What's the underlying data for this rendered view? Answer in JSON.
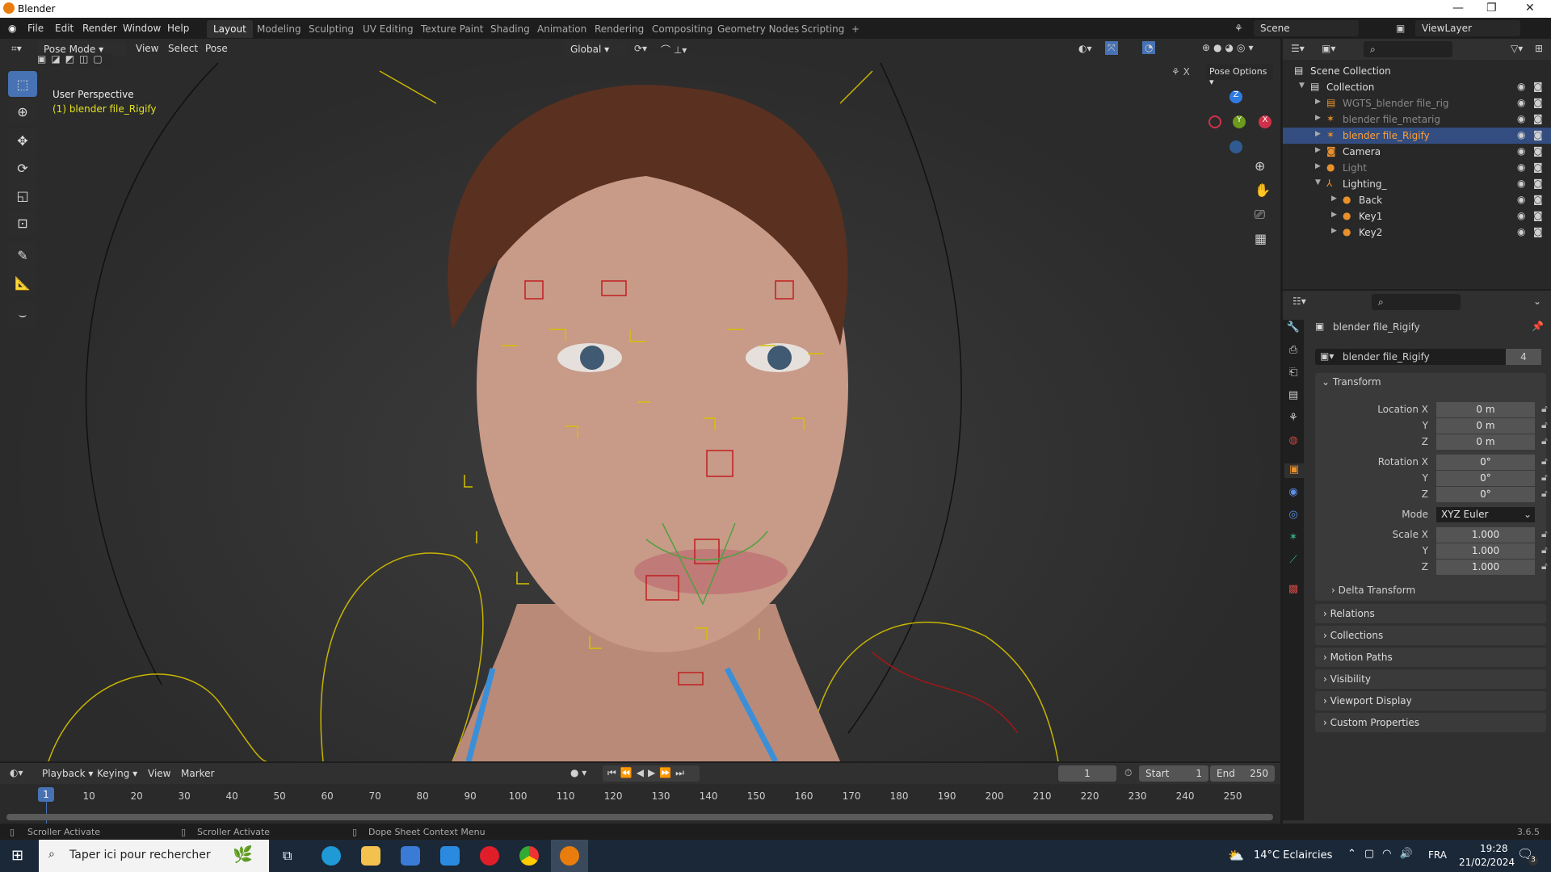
{
  "window": {
    "title": "Blender",
    "controls": [
      "—",
      "❐",
      "✕"
    ]
  },
  "menu": {
    "items": [
      "File",
      "Edit",
      "Render",
      "Window",
      "Help"
    ],
    "workspaces": [
      "Layout",
      "Modeling",
      "Sculpting",
      "UV Editing",
      "Texture Paint",
      "Shading",
      "Animation",
      "Rendering",
      "Compositing",
      "Geometry Nodes",
      "Scripting",
      "+"
    ],
    "active_workspace": "Layout",
    "scene": "Scene",
    "view_layer": "ViewLayer"
  },
  "viewport": {
    "mode": "Pose Mode",
    "menus": [
      "View",
      "Select",
      "Pose"
    ],
    "orientation": "Global",
    "pose_options": "Pose Options",
    "overlay_title": "User Perspective",
    "overlay_object": "(1) blender file_Rigify",
    "gizmo": {
      "x": "X",
      "y": "Y",
      "z": "Z"
    }
  },
  "outliner": {
    "items": [
      {
        "label": "Scene Collection",
        "depth": 0,
        "icon": "▤"
      },
      {
        "label": "Collection",
        "depth": 1,
        "icon": "▤",
        "expanded": true
      },
      {
        "label": "WGTS_blender file_rig",
        "depth": 2,
        "icon": "▤",
        "dim": true
      },
      {
        "label": "blender file_metarig",
        "depth": 2,
        "icon": "✶",
        "dim": true
      },
      {
        "label": "blender file_Rigify",
        "depth": 2,
        "icon": "✶",
        "selected": true
      },
      {
        "label": "Camera",
        "depth": 2,
        "icon": "◙"
      },
      {
        "label": "Light",
        "depth": 2,
        "icon": "●",
        "dim": true
      },
      {
        "label": "Lighting_",
        "depth": 2,
        "icon": "⅄",
        "expanded": true
      },
      {
        "label": "Back",
        "depth": 3,
        "icon": "●"
      },
      {
        "label": "Key1",
        "depth": 3,
        "icon": "●"
      },
      {
        "label": "Key2",
        "depth": 3,
        "icon": "●"
      }
    ]
  },
  "properties": {
    "object_name": "blender file_Rigify",
    "datablock": "blender file_Rigify",
    "users": "4",
    "transform_label": "Transform",
    "rows": [
      {
        "label": "Location X",
        "value": "0 m"
      },
      {
        "label": "Y",
        "value": "0 m"
      },
      {
        "label": "Z",
        "value": "0 m"
      },
      {
        "label": "Rotation X",
        "value": "0°"
      },
      {
        "label": "Y",
        "value": "0°"
      },
      {
        "label": "Z",
        "value": "0°"
      },
      {
        "label": "Mode",
        "value": "XYZ Euler"
      },
      {
        "label": "Scale X",
        "value": "1.000"
      },
      {
        "label": "Y",
        "value": "1.000"
      },
      {
        "label": "Z",
        "value": "1.000"
      }
    ],
    "delta": "Delta Transform",
    "panels": [
      "Relations",
      "Collections",
      "Motion Paths",
      "Visibility",
      "Viewport Display",
      "Custom Properties"
    ],
    "version": "3.6.5"
  },
  "timeline": {
    "menus": [
      "Playback",
      "Keying",
      "View",
      "Marker"
    ],
    "current_frame": "1",
    "start_label": "Start",
    "start": "1",
    "end_label": "End",
    "end": "250",
    "ticks": [
      "10",
      "20",
      "30",
      "40",
      "50",
      "60",
      "70",
      "80",
      "90",
      "100",
      "110",
      "120",
      "130",
      "140",
      "150",
      "160",
      "170",
      "180",
      "190",
      "200",
      "210",
      "220",
      "230",
      "240",
      "250"
    ]
  },
  "status": [
    "Scroller Activate",
    "Scroller Activate",
    "Dope Sheet Context Menu"
  ],
  "taskbar": {
    "search_placeholder": "Taper ici pour rechercher",
    "weather": "14°C  Eclaircies",
    "lang": "FRA",
    "time": "19:28",
    "date": "21/02/2024",
    "notifications": "3"
  }
}
